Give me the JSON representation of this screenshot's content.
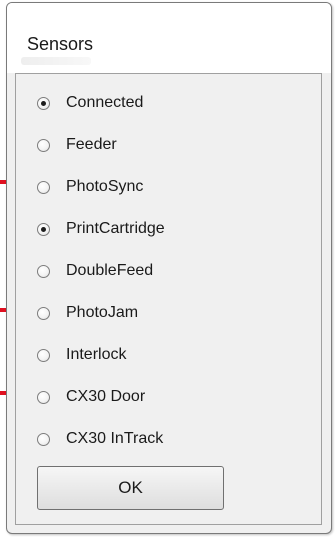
{
  "dialog": {
    "title": "Sensors"
  },
  "sensors": {
    "options": [
      {
        "label": "Connected",
        "checked": true
      },
      {
        "label": "Feeder",
        "checked": false
      },
      {
        "label": "PhotoSync",
        "checked": false
      },
      {
        "label": "PrintCartridge",
        "checked": true
      },
      {
        "label": "DoubleFeed",
        "checked": false
      },
      {
        "label": "PhotoJam",
        "checked": false
      },
      {
        "label": "Interlock",
        "checked": false
      },
      {
        "label": "CX30 Door",
        "checked": false
      },
      {
        "label": "CX30 InTrack",
        "checked": false
      }
    ]
  },
  "buttons": {
    "ok_label": "OK"
  },
  "colors": {
    "annotation_arrow": "#e01020",
    "dialog_background": "#f0f0f0",
    "title_area": "#ffffff"
  }
}
